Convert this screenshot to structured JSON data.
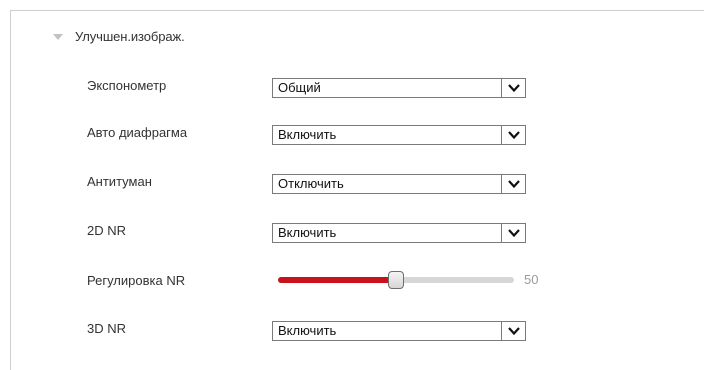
{
  "section": {
    "title": "Улучшен.изображ."
  },
  "rows": [
    {
      "label": "Экспонометр",
      "value": "Общий"
    },
    {
      "label": "Авто диафрагма",
      "value": "Включить"
    },
    {
      "label": "Антитуман",
      "value": "Отключить"
    },
    {
      "label": "2D NR",
      "value": "Включить"
    }
  ],
  "nr_adjust": {
    "label": "Регулировка NR",
    "value": "50",
    "fraction": 0.5
  },
  "row_3d": {
    "label": "3D NR",
    "value": "Включить"
  },
  "icons": {
    "collapse": "triangle-down-icon",
    "dropdown": "chevron-down-icon"
  },
  "colors": {
    "slider_fill": "#c8131f",
    "slider_track": "#d7d7d7"
  }
}
